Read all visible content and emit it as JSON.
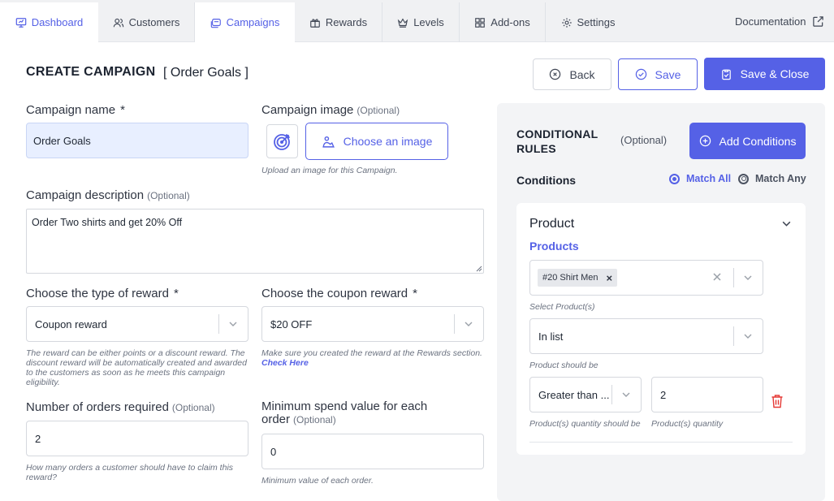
{
  "nav": {
    "tabs": [
      {
        "label": "Dashboard",
        "icon": "dashboard-icon"
      },
      {
        "label": "Customers",
        "icon": "customers-icon"
      },
      {
        "label": "Campaigns",
        "icon": "campaigns-icon"
      },
      {
        "label": "Rewards",
        "icon": "rewards-icon"
      },
      {
        "label": "Levels",
        "icon": "levels-icon"
      },
      {
        "label": "Add-ons",
        "icon": "addons-icon"
      },
      {
        "label": "Settings",
        "icon": "settings-icon"
      }
    ],
    "active_tab": "Campaigns",
    "documentation": "Documentation"
  },
  "header": {
    "title": "CREATE CAMPAIGN",
    "subtitle": "[ Order Goals ]",
    "back_label": "Back",
    "save_label": "Save",
    "save_close_label": "Save & Close"
  },
  "form": {
    "name_label": "Campaign name",
    "name_required": "*",
    "name_value": "Order Goals",
    "image_label": "Campaign image",
    "image_optional": "(Optional)",
    "image_button": "Choose an image",
    "image_help": "Upload an image for this Campaign.",
    "desc_label": "Campaign description",
    "desc_optional": "(Optional)",
    "desc_value": "Order Two shirts and get 20% Off",
    "reward_type_label": "Choose the type of reward",
    "reward_type_required": "*",
    "reward_type_value": "Coupon reward",
    "reward_type_help": "The reward can be either points or a discount reward. The discount reward will be automatically created and awarded to the customers as soon as he meets this campaign eligibility.",
    "coupon_label": "Choose the coupon reward",
    "coupon_required": "*",
    "coupon_value": "$20 OFF",
    "coupon_help": "Make sure you created the reward at the Rewards section.",
    "coupon_help_link": "Check Here",
    "orders_label": "Number of orders required",
    "orders_optional": "(Optional)",
    "orders_value": "2",
    "orders_help": "How many orders a customer should have to claim this reward?",
    "min_spend_label_1": "Minimum spend value for each",
    "min_spend_label_2": "order",
    "min_spend_optional": "(Optional)",
    "min_spend_value": "0",
    "min_spend_help": "Minimum value of each order."
  },
  "conditions": {
    "title_line1": "CONDITIONAL",
    "title_line2": "RULES",
    "optional": "(Optional)",
    "add_button": "Add Conditions",
    "label": "Conditions",
    "match_all": "Match All",
    "match_any": "Match Any",
    "selected_match": "Match All",
    "card": {
      "title": "Product",
      "products_label": "Products",
      "product_chip": "#20 Shirt Men",
      "select_products_help": "Select Product(s)",
      "list_value": "In list",
      "list_help": "Product should be",
      "quantity_op_value": "Greater than ...",
      "quantity_op_help": "Product(s) quantity should be",
      "quantity_value": "2",
      "quantity_help": "Product(s) quantity"
    }
  },
  "colors": {
    "accent": "#5561e6",
    "nav_bg": "#f0f1f3",
    "panel_bg": "#f3f4f6",
    "danger": "#e53935"
  }
}
